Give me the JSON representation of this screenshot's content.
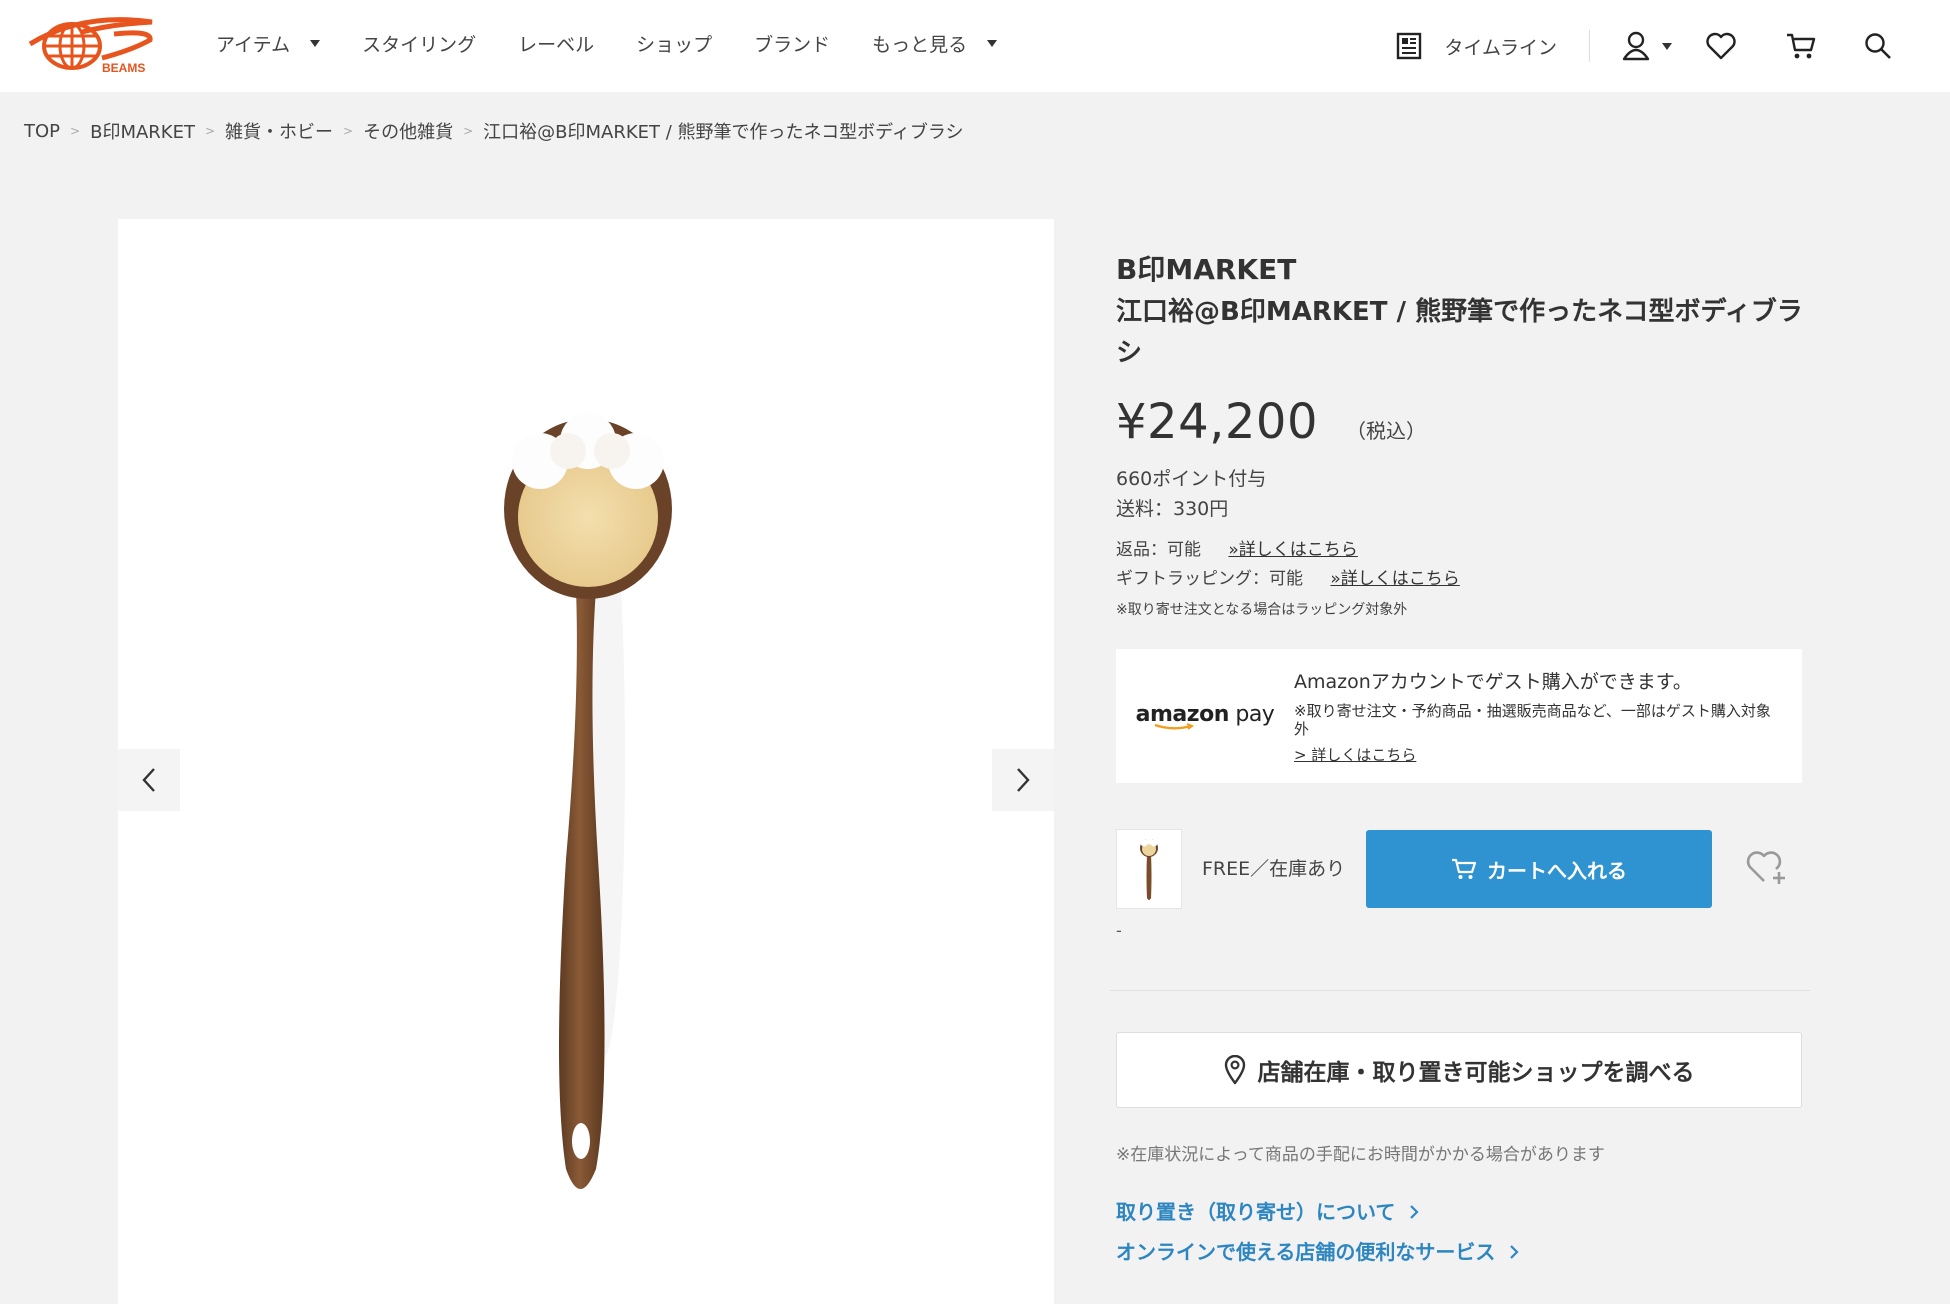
{
  "header": {
    "logo_text": "BEAMS",
    "nav": [
      {
        "label": "アイテム",
        "dropdown": true
      },
      {
        "label": "スタイリング",
        "dropdown": false
      },
      {
        "label": "レーベル",
        "dropdown": false
      },
      {
        "label": "ショップ",
        "dropdown": false
      },
      {
        "label": "ブランド",
        "dropdown": false
      },
      {
        "label": "もっと見る",
        "dropdown": true
      }
    ],
    "timeline_label": "タイムライン",
    "icons": [
      "newspaper-icon",
      "user-icon",
      "heart-icon",
      "cart-icon",
      "search-icon"
    ],
    "brand_color": "#e8541e"
  },
  "breadcrumb": {
    "items": [
      "TOP",
      "B印MARKET",
      "雑貨・ホビー",
      "その他雑貨"
    ],
    "current": "江口裕@B印MARKET / 熊野筆で作ったネコ型ボディブラシ",
    "separator": ">"
  },
  "gallery": {
    "prev_icon": "chevron-left-icon",
    "next_icon": "chevron-right-icon"
  },
  "product": {
    "brand": "B印MARKET",
    "title": "江口裕@B印MARKET / 熊野筆で作ったネコ型ボディブラシ",
    "price": "¥24,200",
    "tax_label": "（税込）",
    "points": "660ポイント付与",
    "shipping": "送料：330円",
    "returns": "返品：可能",
    "returns_link": "»詳しくはこちら",
    "gift": "ギフトラッピング：可能",
    "gift_link": "»詳しくはこちら",
    "gift_note": "※取り寄せ注文となる場合はラッピング対象外"
  },
  "amazon": {
    "logo_bold": "amazon",
    "logo_rest": " pay",
    "headline": "Amazonアカウントでゲスト購入ができます。",
    "note": "※取り寄せ注文・予約商品・抽選販売商品など、一部はゲスト購入対象外",
    "link": "> 詳しくはこちら"
  },
  "variant": {
    "label": "FREE／在庫あり",
    "cart_button": "カートへ入れる",
    "dash": "-"
  },
  "store": {
    "button": "店舗在庫・取り置き可能ショップを調べる",
    "note": "※在庫状況によって商品の手配にお時間がかかる場合があります",
    "link1": "取り置き（取り寄せ）について",
    "link2": "オンラインで使える店舗の便利なサービス"
  },
  "colors": {
    "accent_blue": "#2e93d0",
    "link_blue": "#2e86c1",
    "background": "#f2f2f2"
  }
}
